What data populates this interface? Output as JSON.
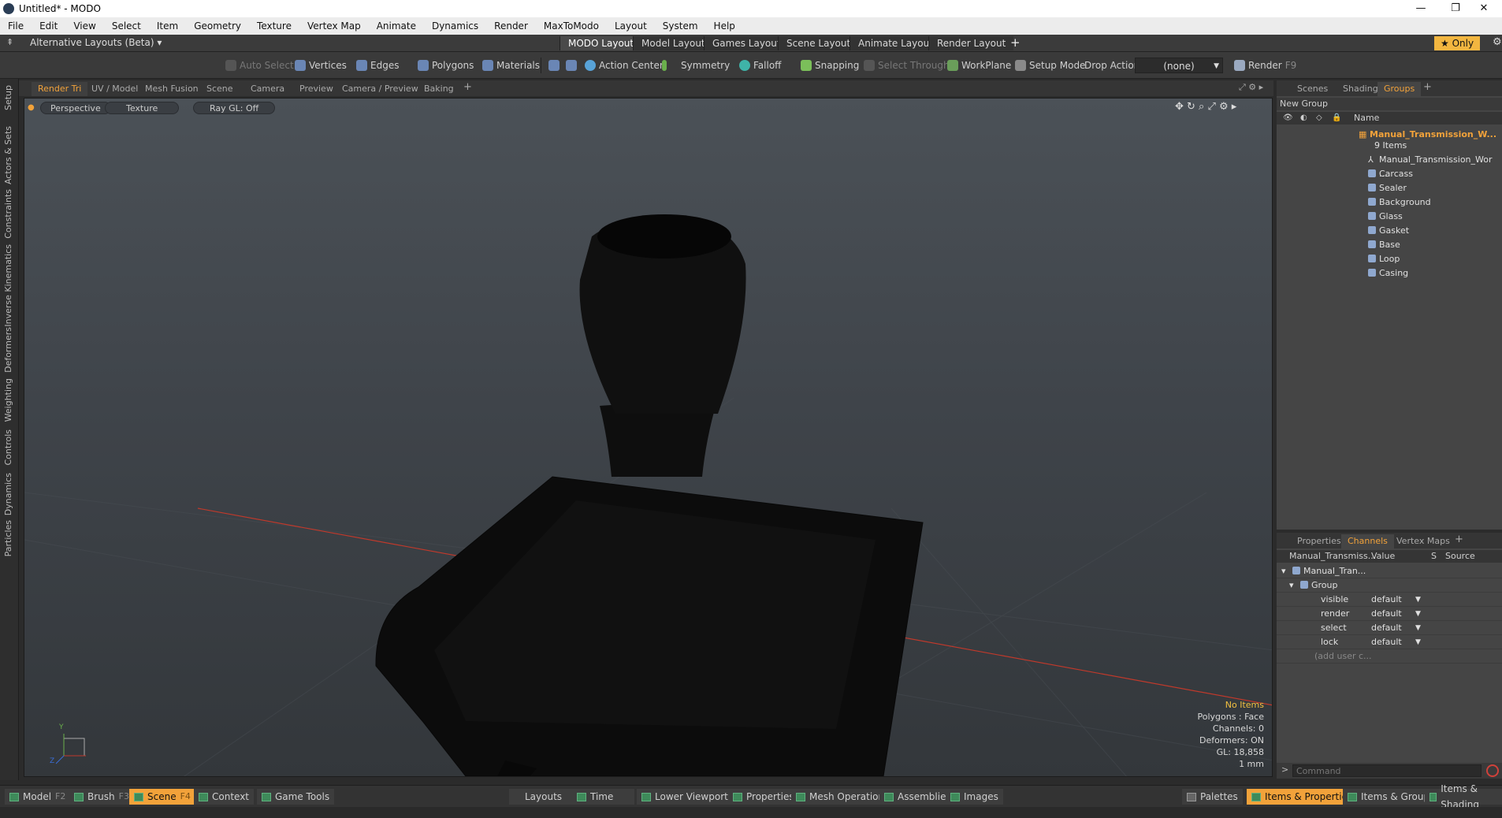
{
  "window": {
    "title": "Untitled* - MODO"
  },
  "menu": [
    "File",
    "Edit",
    "View",
    "Select",
    "Item",
    "Geometry",
    "Texture",
    "Vertex Map",
    "Animate",
    "Dynamics",
    "Render",
    "MaxToModo",
    "Layout",
    "System",
    "Help"
  ],
  "layoutbar": {
    "alt_layouts": "Alternative Layouts (Beta) ▾",
    "tabs": [
      "MODO Layout",
      "Model Layout",
      "Games Layout",
      "Scene Layout",
      "Animate Layout",
      "Render Layout"
    ],
    "active_tab": "MODO Layout",
    "add": "+",
    "only": "★ Only"
  },
  "toolbar": {
    "auto_select": "Auto Select",
    "vertices": "Vertices",
    "edges": "Edges",
    "polygons": "Polygons",
    "materials": "Materials",
    "action_center": "Action Center",
    "symmetry": "Symmetry",
    "falloff": "Falloff",
    "snapping": "Snapping",
    "select_through": "Select Through",
    "workplane": "WorkPlane",
    "setup_mode": "Setup Mode",
    "drop_action": "Drop Action",
    "drop_value": "(none)",
    "render": "Render",
    "render_key": "F9"
  },
  "left_tabs": [
    "Setup",
    "Actors & Sets",
    "Constraints",
    "Inverse Kinematics",
    "Deformers",
    "Weighting",
    "Controls",
    "Dynamics",
    "Particles"
  ],
  "viewport_tabs": [
    "Render Tri",
    "UV / Model",
    "Mesh Fusion",
    "Scene",
    "Camera",
    "Preview",
    "Camera / Preview",
    "Baking"
  ],
  "viewport": {
    "view": "Perspective",
    "shading": "Texture",
    "raygl": "Ray GL: Off",
    "info": {
      "items": "No Items",
      "polygons": "Polygons : Face",
      "channels": "Channels: 0",
      "deformers": "Deformers: ON",
      "gl": "GL: 18,858",
      "unit": "1 mm"
    },
    "axis_y": "Y",
    "axis_z": "Z"
  },
  "groups_panel": {
    "tabs": [
      "Scenes",
      "Shading",
      "Groups"
    ],
    "new_group": "New Group",
    "col_name": "Name",
    "group_name": "Manual_Transmission_W...",
    "group_count": "9 Items",
    "children": [
      "Manual_Transmission_Wor ...",
      "Carcass",
      "Sealer",
      "Background",
      "Glass",
      "Gasket",
      "Base",
      "Loop",
      "Casing"
    ]
  },
  "channels_panel": {
    "tabs": [
      "Properties",
      "Channels",
      "Vertex Maps"
    ],
    "col_item": "Manual_Transmiss...",
    "col_value": "Value",
    "col_s": "S",
    "col_source": "Source",
    "root": "Manual_Tran...",
    "group": "Group",
    "rows": [
      {
        "name": "visible",
        "value": "default"
      },
      {
        "name": "render",
        "value": "default"
      },
      {
        "name": "select",
        "value": "default"
      },
      {
        "name": "lock",
        "value": "default"
      }
    ],
    "add_user": "(add user c..."
  },
  "command": {
    "placeholder": "Command"
  },
  "bottombar": {
    "model": "Model",
    "model_key": "F2",
    "brush": "Brush",
    "brush_key": "F3",
    "scene": "Scene",
    "scene_key": "F4",
    "context": "Context",
    "game_tools": "Game Tools",
    "layouts": "Layouts",
    "time": "Time",
    "lower_viewports": "Lower Viewports",
    "properties": "Properties",
    "mesh_operations": "Mesh Operations",
    "assemblies": "Assemblies",
    "images": "Images",
    "palettes": "Palettes",
    "items_properties": "Items & Properties",
    "items_groups": "Items & Groups",
    "items_shading": "Items & Shading"
  }
}
